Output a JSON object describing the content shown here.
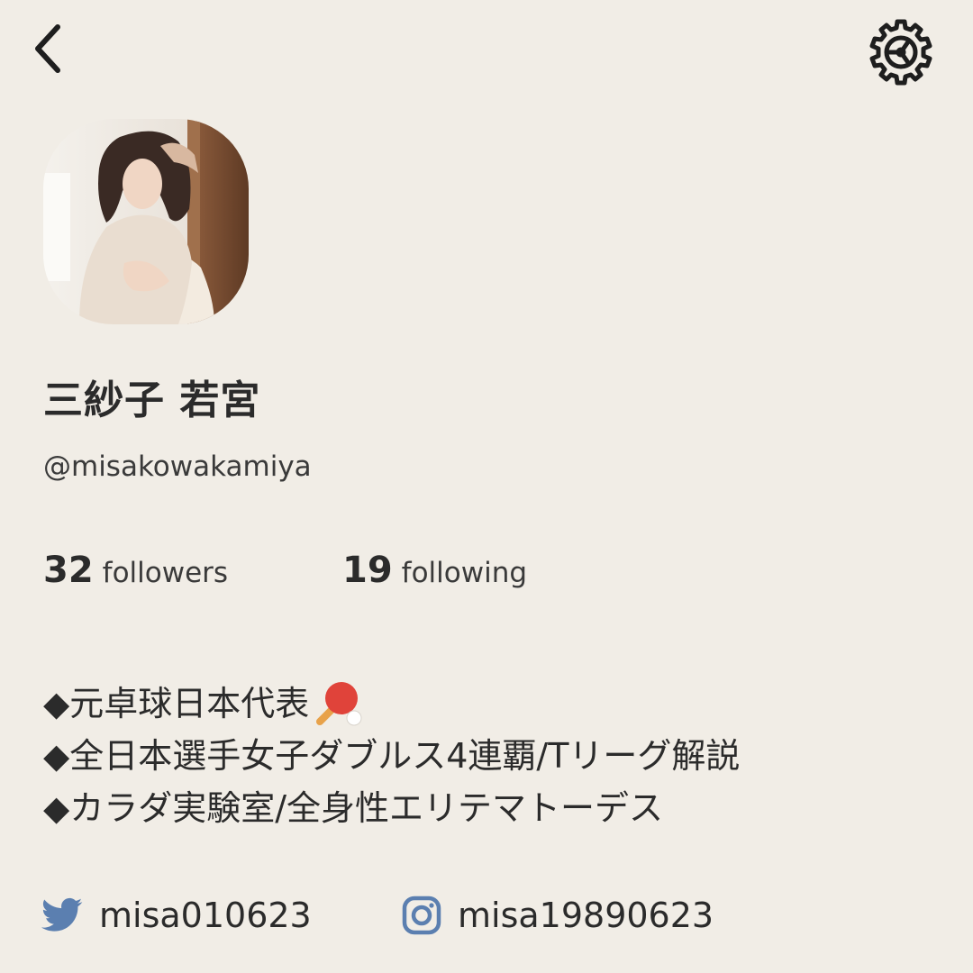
{
  "header": {
    "back_icon": "chevron-left-icon",
    "settings_icon": "gear-icon"
  },
  "profile": {
    "display_name": "三紗子 若宮",
    "username": "@misakowakamiya",
    "avatar_icon": "profile-photo"
  },
  "stats": {
    "followers_count": "32",
    "followers_label": "followers",
    "following_count": "19",
    "following_label": "following"
  },
  "bio": {
    "lines": [
      "◆元卓球日本代表",
      "◆全日本選手女子ダブルス4連覇/Tリーグ解説",
      "◆カラダ実験室/全身性エリテマトーデス"
    ],
    "emoji_icon": "ping-pong-paddle-icon"
  },
  "social": {
    "twitter_icon": "twitter-bird-icon",
    "twitter_handle": "misa010623",
    "instagram_icon": "instagram-icon",
    "instagram_handle": "misa19890623"
  },
  "colors": {
    "background": "#f1ede6",
    "text": "#2b2b2b",
    "social_icon": "#5b7fb0",
    "paddle": "#e0433a"
  }
}
